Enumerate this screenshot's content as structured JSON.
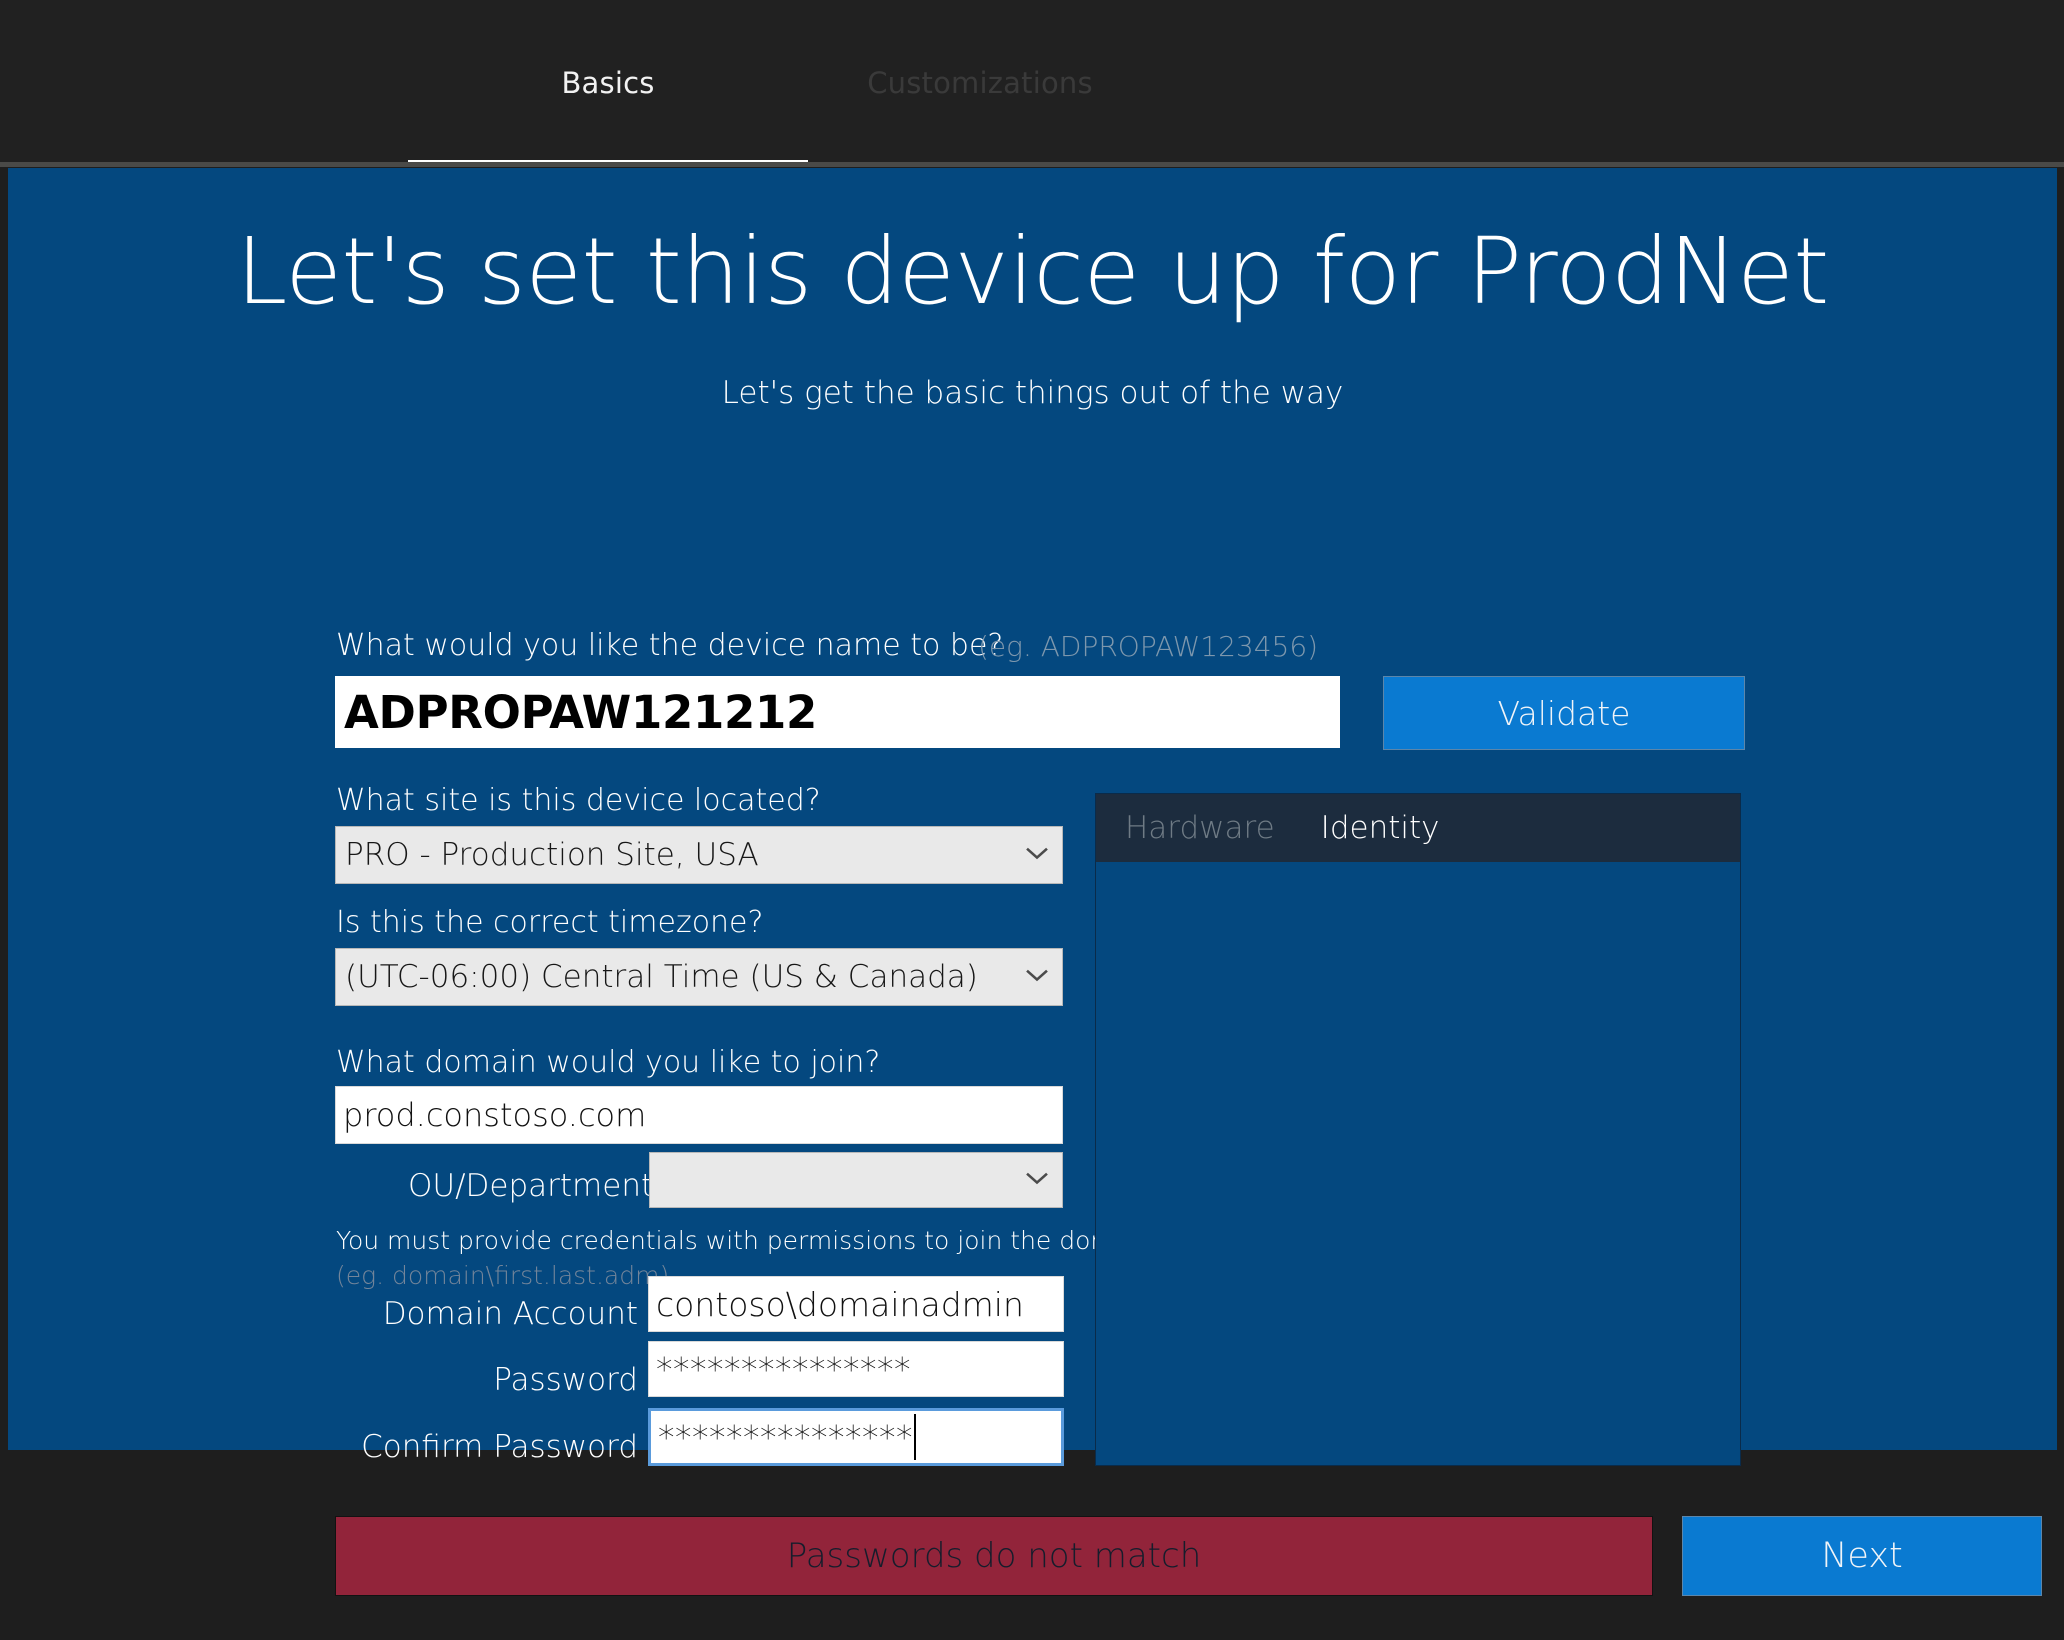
{
  "tabs": [
    {
      "label": "Basics",
      "active": true
    },
    {
      "label": "Customizations",
      "active": false
    }
  ],
  "page": {
    "title": "Let's set this device up for ProdNet",
    "subtitle": "Let's get the basic things out of the way"
  },
  "device_name": {
    "label": "What would you like the device name to be?",
    "hint": "(eg. ADPROPAW123456)",
    "value": "ADPROPAW121212",
    "placeholder": "ADPROPAW123456",
    "validate_label": "Validate"
  },
  "site": {
    "label": "What site is this device located?",
    "value": "PRO - Production Site, USA",
    "chevron": "chevron-down-icon"
  },
  "timezone": {
    "label": "Is this the correct timezone?",
    "value": "(UTC-06:00) Central Time (US & Canada)",
    "chevron": "chevron-down-icon"
  },
  "domain": {
    "label": "What domain would you like to join?",
    "value": "prod.constoso.com",
    "placeholder": ""
  },
  "ou": {
    "label": "OU/Department",
    "value": "",
    "chevron": "chevron-down-icon"
  },
  "credentials": {
    "note": "You must provide credentials with permissions to join the domain",
    "hint": "(eg. domain\\first.last.adm)",
    "account_label": "Domain Account",
    "account_value": "contoso\\domainadmin",
    "password_label": "Password",
    "password_value": "***************",
    "confirm_label": "Confirm Password",
    "confirm_value": "***************"
  },
  "info_panel": {
    "tabs": [
      {
        "label": "Hardware",
        "active": false
      },
      {
        "label": "Identity",
        "active": true
      }
    ],
    "body_text": ""
  },
  "footer": {
    "status_message": "Passwords do not match",
    "next_label": "Next"
  },
  "colors": {
    "page_background": "#04487f",
    "app_background": "#1e1e1e",
    "tabstrip_background": "#212121",
    "accent_blue": "#0a7ad1",
    "error_red": "#92243a",
    "panel_header": "#1c2c3e",
    "focus_border": "#5a9bdc"
  }
}
